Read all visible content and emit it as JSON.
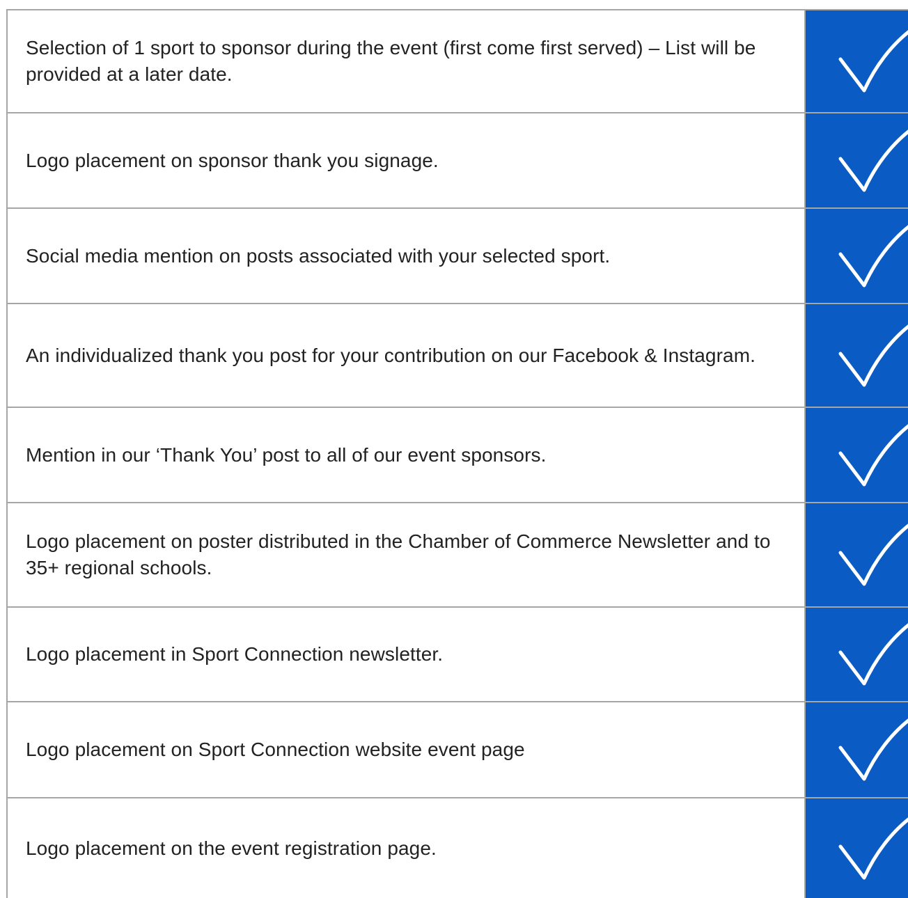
{
  "benefits": [
    {
      "text": "Selection of 1 sport to sponsor during the event (first come first served) – List will be provided at a later date.",
      "included": true
    },
    {
      "text": "Logo placement on sponsor thank you signage.",
      "included": true
    },
    {
      "text": "Social media mention on posts associated with your selected sport.",
      "included": true
    },
    {
      "text": "An individualized thank you post for your contribution on our Facebook & Instagram.",
      "included": true
    },
    {
      "text": "Mention in our ‘Thank You’ post to all of our event sponsors.",
      "included": true
    },
    {
      "text": "Logo placement on poster distributed in the Chamber of Commerce Newsletter and to 35+ regional schools.",
      "included": true
    },
    {
      "text": "Logo placement in Sport Connection newsletter.",
      "included": true
    },
    {
      "text": "Logo placement on Sport Connection website event page",
      "included": true
    },
    {
      "text": "Logo placement on the event registration page.",
      "included": true
    }
  ],
  "colors": {
    "check_column": "#0a5bc4",
    "check_mark": "#ffffff",
    "grid_line": "#a6a6a6",
    "text": "#222222"
  },
  "icons": {
    "check": "checkmark-icon"
  }
}
